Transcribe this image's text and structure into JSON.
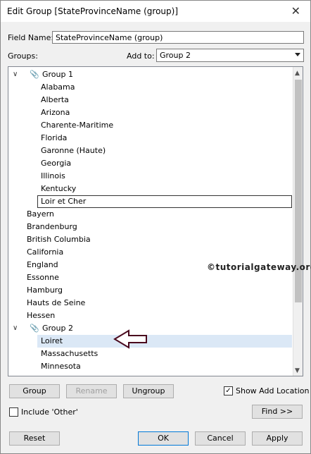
{
  "window": {
    "title": "Edit Group [StateProvinceName (group)]",
    "close_glyph": "✕"
  },
  "field_name": {
    "label": "Field Name:",
    "value": "StateProvinceName (group)"
  },
  "groups_label": "Groups:",
  "add_to": {
    "label": "Add to:",
    "value": "Group 2"
  },
  "tree": {
    "group1": {
      "name": "Group 1",
      "members": [
        "Alabama",
        "Alberta",
        "Arizona",
        "Charente-Maritime",
        "Florida",
        "Garonne (Haute)",
        "Georgia",
        "Illinois",
        "Kentucky",
        "Loir et Cher"
      ]
    },
    "ungrouped": [
      "Bayern",
      "Brandenburg",
      "British Columbia",
      "California",
      "England",
      "Essonne",
      "Hamburg",
      "Hauts de Seine",
      "Hessen"
    ],
    "group2": {
      "name": "Group 2",
      "members": [
        "Loiret",
        "Massachusetts",
        "Minnesota"
      ]
    }
  },
  "watermark": "©tutorialgateway.org",
  "buttons": {
    "group": "Group",
    "rename": "Rename",
    "ungroup": "Ungroup",
    "find": "Find >>",
    "reset": "Reset",
    "ok": "OK",
    "cancel": "Cancel",
    "apply": "Apply"
  },
  "show_add_location": {
    "label": "Show Add Location",
    "checked": true
  },
  "include_other": {
    "label": "Include 'Other'",
    "checked": false
  }
}
